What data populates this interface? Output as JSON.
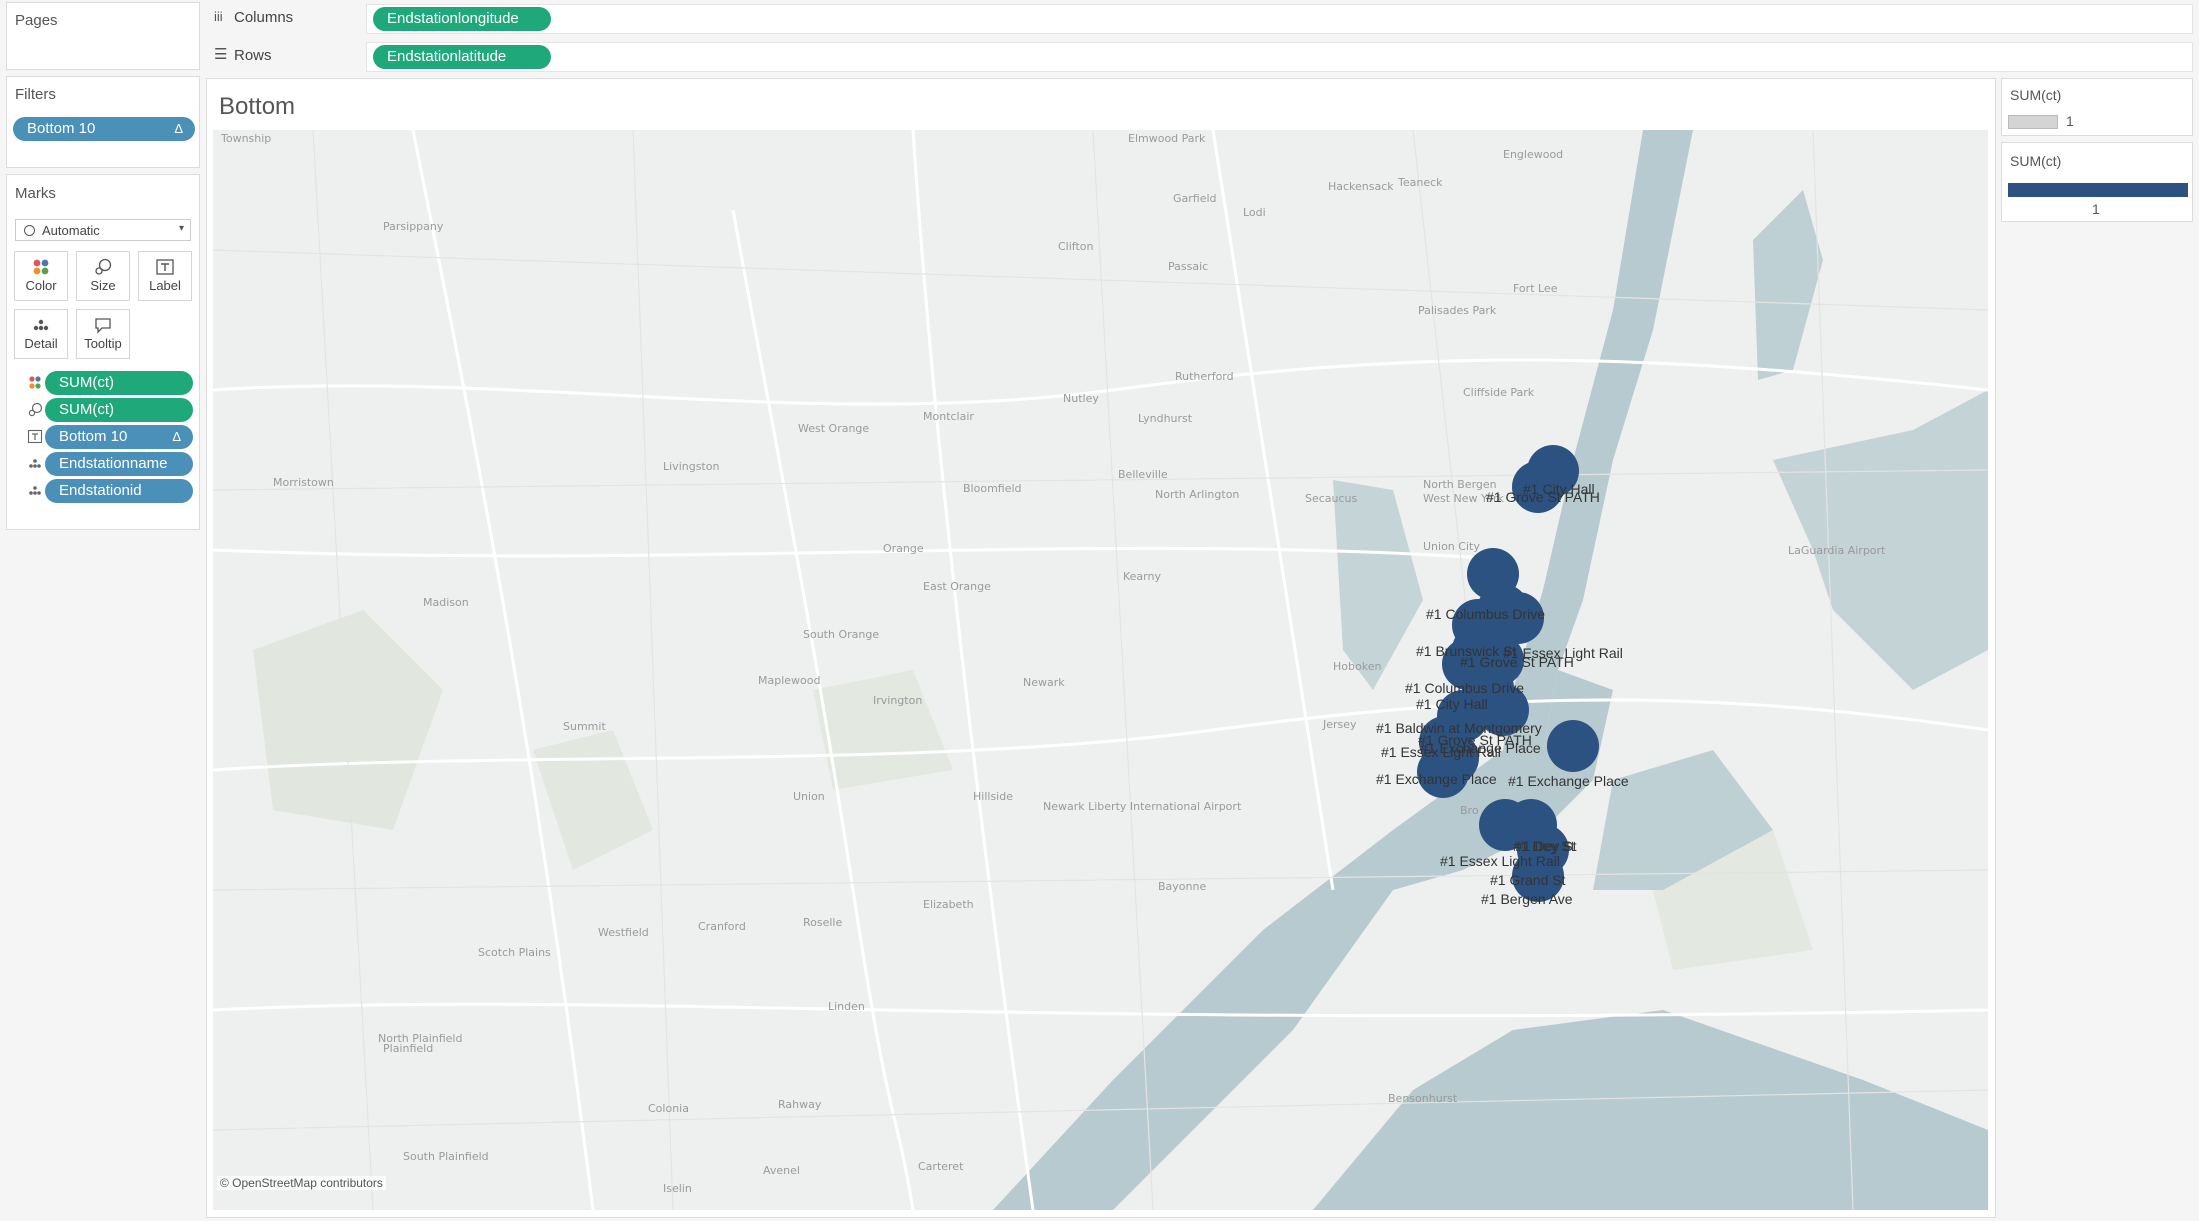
{
  "pages": {
    "title": "Pages"
  },
  "shelves": {
    "columns": {
      "icon": "columns-icon",
      "label": "Columns",
      "pill": "Endstationlongitude"
    },
    "rows": {
      "icon": "rows-icon",
      "label": "Rows",
      "pill": "Endstationlatitude"
    }
  },
  "filters": {
    "title": "Filters",
    "items": [
      {
        "label": "Bottom 10",
        "badge": "Δ"
      }
    ]
  },
  "marks": {
    "title": "Marks",
    "type_select": {
      "icon": "circle-icon",
      "value": "Automatic"
    },
    "buttons": [
      {
        "label": "Color",
        "icon": "color-dots-icon"
      },
      {
        "label": "Size",
        "icon": "size-shapes-icon"
      },
      {
        "label": "Label",
        "icon": "label-text-icon"
      },
      {
        "label": "Detail",
        "icon": "detail-dots-icon"
      },
      {
        "label": "Tooltip",
        "icon": "tooltip-bubble-icon"
      }
    ],
    "fields": [
      {
        "icon": "color-dots-icon",
        "label": "SUM(ct)",
        "color": "#1fa97b"
      },
      {
        "icon": "size-shapes-icon",
        "label": "SUM(ct)",
        "color": "#1fa97b"
      },
      {
        "icon": "label-text-icon",
        "label": "Bottom 10",
        "badge": "Δ",
        "color": "#4a90b8"
      },
      {
        "icon": "detail-dots-icon",
        "label": "Endstationname",
        "color": "#4a90b8"
      },
      {
        "icon": "detail-dots-icon",
        "label": "Endstationid",
        "color": "#4a90b8"
      }
    ]
  },
  "view": {
    "title": "Bottom",
    "attribution": "© OpenStreetMap contributors",
    "map_places": [
      "Township",
      "Elmwood Park",
      "Englewood",
      "Hackensack",
      "Teaneck",
      "Garfield",
      "Lodi",
      "Parsippany",
      "Clifton",
      "Passaic",
      "Fort Lee",
      "Palisades Park",
      "Rutherford",
      "Nutley",
      "Lyndhurst",
      "Cliffside Park",
      "Montclair",
      "West Orange",
      "Livingston",
      "Bloomfield",
      "Belleville",
      "North Arlington",
      "North Bergen",
      "West New York",
      "Secaucus",
      "Morristown",
      "Union City",
      "Orange",
      "Kearny",
      "East Orange",
      "Madison",
      "South Orange",
      "Hoboken",
      "Newark",
      "Maplewood",
      "Irvington",
      "Jersey",
      "Summit",
      "Union",
      "Hillside",
      "Elizabeth",
      "Bayonne",
      "Westfield",
      "Cranford",
      "Roselle",
      "Scotch Plains",
      "Linden",
      "North Plainfield",
      "Plainfield",
      "Rahway",
      "Colonia",
      "South Plainfield",
      "Avenel",
      "Carteret",
      "Iselin",
      "Bensonhurst",
      "LaGuardia Airport",
      "Newark Liberty International Airport",
      "Bro"
    ],
    "marks_labels": [
      "#1 City Hall",
      "#1 Grove St PATH",
      "#1 Columbus Drive",
      "#1 Brunswick St",
      "#1 Essex Light Rail",
      "#1 Grove St PATH",
      "#1 Columbus Drive",
      "#1 Dey St",
      "#1 City Hall",
      "#1 Baldwin at Montgomery",
      "#1 Grove St PATH",
      "#1 Exchange Place",
      "#1 Essex Light Rail",
      "#1 Exchange Place",
      "#1 Exchange Place",
      "#1 Dey St",
      "#1 Essex Light Rail",
      "#1 Grand St",
      "#1 Bergen Ave"
    ],
    "mark_color": "#2c5282"
  },
  "legends": {
    "color": {
      "title": "SUM(ct)",
      "value": "1",
      "swatch_color": "#d4d4d4"
    },
    "size": {
      "title": "SUM(ct)",
      "value": "1",
      "bar_color": "#2c5282"
    }
  }
}
